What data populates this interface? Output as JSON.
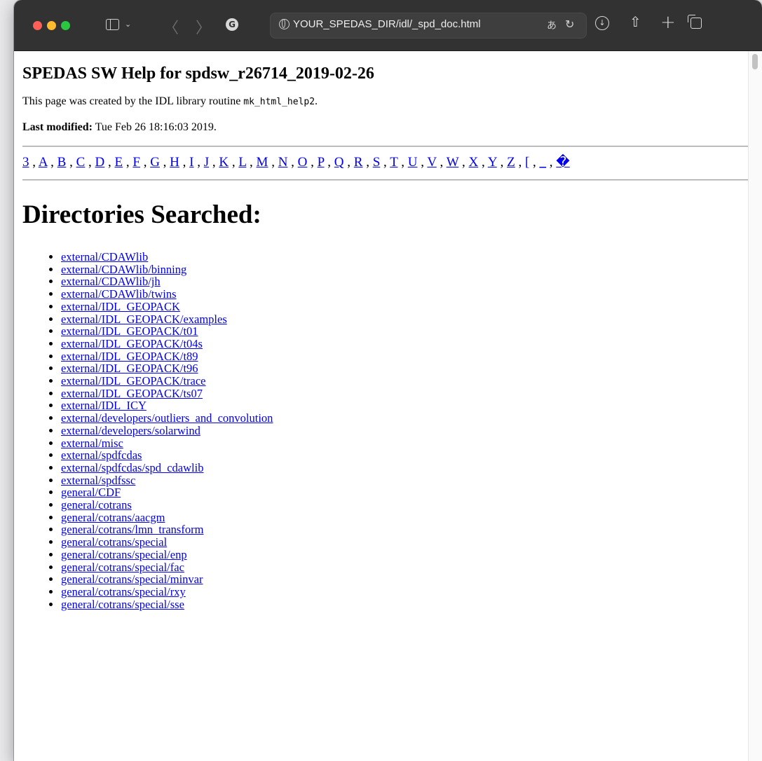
{
  "browser": {
    "url": "YOUR_SPEDAS_DIR/idl/_spd_doc.html",
    "back_glyph": "〈",
    "forward_glyph": "〉",
    "site_initial": "G"
  },
  "page": {
    "title": "SPEDAS SW Help for spdsw_r26714_2019-02-26",
    "created_text": "This page was created by the IDL library routine ",
    "created_code": "mk_html_help2",
    "created_end": ".",
    "last_modified_label": "Last modified:",
    "last_modified_value": " Tue Feb 26 18:16:03 2019.",
    "alphabet": [
      "3",
      "A",
      "B",
      "C",
      "D",
      "E",
      "F",
      "G",
      "H",
      "I",
      "J",
      "K",
      "L",
      "M",
      "N",
      "O",
      "P",
      "Q",
      "R",
      "S",
      "T",
      "U",
      "V",
      "W",
      "X",
      "Y",
      "Z",
      "[",
      "_",
      "�"
    ],
    "separator": " , ",
    "heading": "Directories Searched:",
    "directories": [
      "external/CDAWlib",
      "external/CDAWlib/binning",
      "external/CDAWlib/jh",
      "external/CDAWlib/twins",
      "external/IDL_GEOPACK",
      "external/IDL_GEOPACK/examples",
      "external/IDL_GEOPACK/t01",
      "external/IDL_GEOPACK/t04s",
      "external/IDL_GEOPACK/t89",
      "external/IDL_GEOPACK/t96",
      "external/IDL_GEOPACK/trace",
      "external/IDL_GEOPACK/ts07",
      "external/IDL_ICY",
      "external/developers/outliers_and_convolution",
      "external/developers/solarwind",
      "external/misc",
      "external/spdfcdas",
      "external/spdfcdas/spd_cdawlib",
      "external/spdfssc",
      "general/CDF",
      "general/cotrans",
      "general/cotrans/aacgm",
      "general/cotrans/lmn_transform",
      "general/cotrans/special",
      "general/cotrans/special/enp",
      "general/cotrans/special/fac",
      "general/cotrans/special/minvar",
      "general/cotrans/special/rxy",
      "general/cotrans/special/sse"
    ]
  }
}
